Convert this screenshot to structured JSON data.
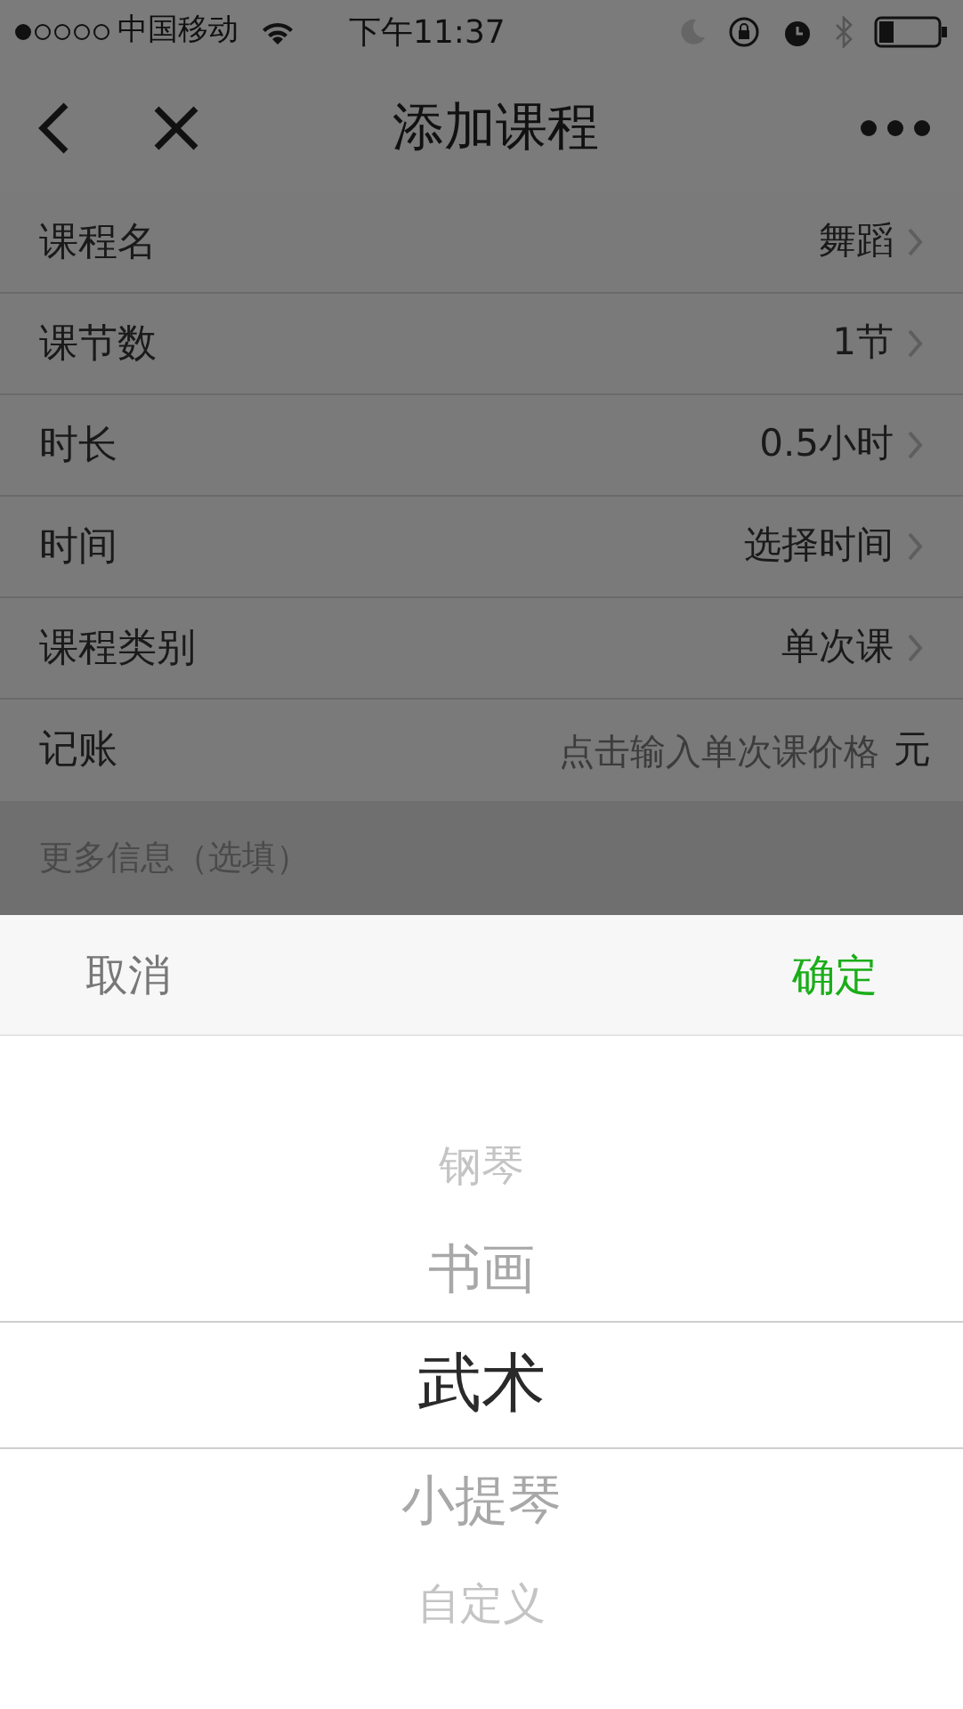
{
  "status_bar": {
    "carrier": "中国移动",
    "time": "下午11:37"
  },
  "nav": {
    "title": "添加课程"
  },
  "form_rows": [
    {
      "kind": "select",
      "label": "课程名",
      "value": "舞蹈"
    },
    {
      "kind": "select",
      "label": "课节数",
      "value": "1节"
    },
    {
      "kind": "select",
      "label": "时长",
      "value": "0.5小时"
    },
    {
      "kind": "select",
      "label": "时间",
      "value": "选择时间"
    },
    {
      "kind": "select",
      "label": "课程类别",
      "value": "单次课"
    },
    {
      "kind": "input",
      "label": "记账",
      "placeholder": "点击输入单次课价格",
      "unit": "元"
    }
  ],
  "section_header": "更多信息（选填）",
  "picker": {
    "cancel": "取消",
    "confirm": "确定",
    "options": [
      {
        "label": "钢琴",
        "selected": false
      },
      {
        "label": "书画",
        "selected": false
      },
      {
        "label": "武术",
        "selected": true
      },
      {
        "label": "小提琴",
        "selected": false
      },
      {
        "label": "自定义",
        "selected": false
      }
    ]
  }
}
